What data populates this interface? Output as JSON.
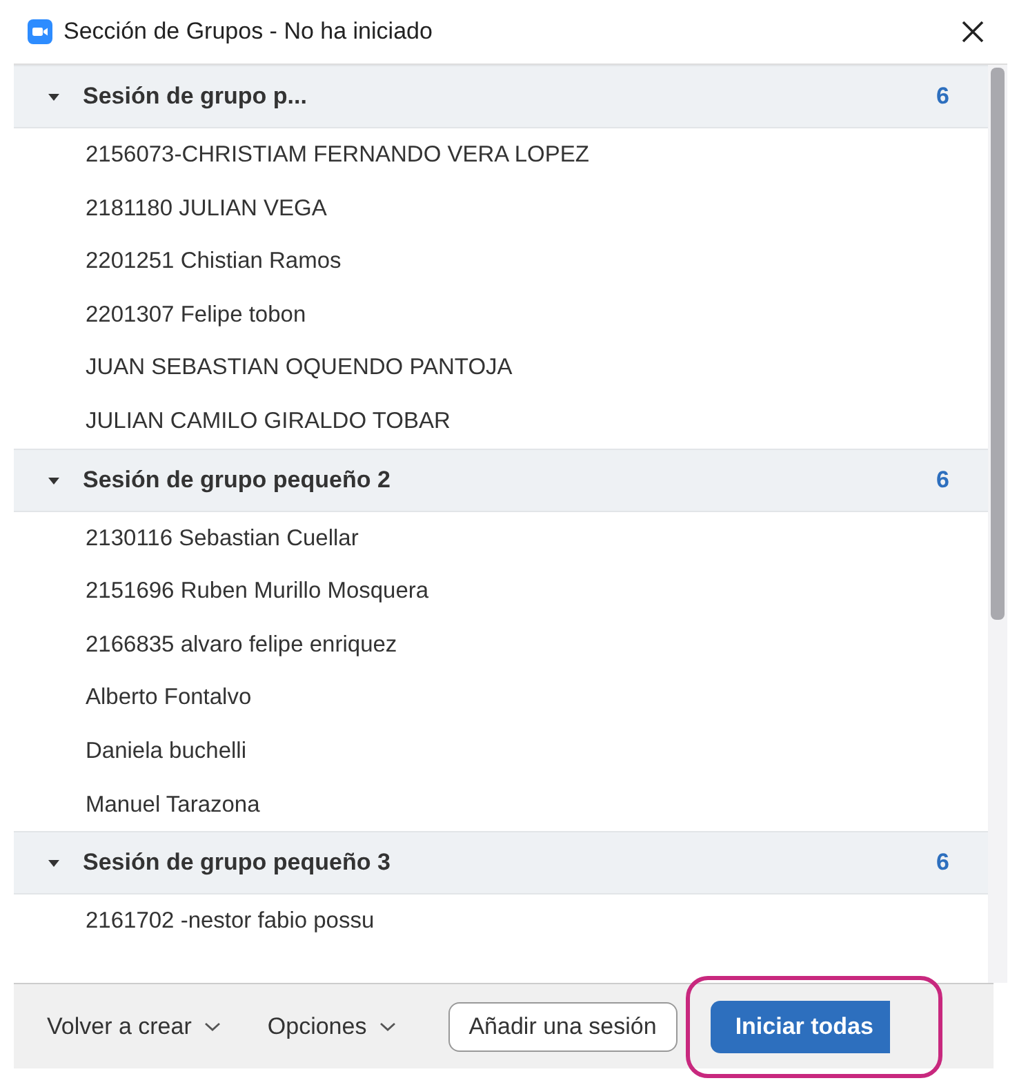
{
  "window": {
    "title": "Sección de Grupos - No ha iniciado"
  },
  "groups": [
    {
      "name": "Sesión de grupo p...",
      "count": "6",
      "expanded": true,
      "members": [
        "2156073-CHRISTIAM FERNANDO VERA LOPEZ",
        "2181180 JULIAN VEGA",
        "2201251 Chistian Ramos",
        "2201307 Felipe tobon",
        "JUAN SEBASTIAN OQUENDO PANTOJA",
        "JULIAN CAMILO GIRALDO TOBAR"
      ]
    },
    {
      "name": "Sesión de grupo pequeño 2",
      "count": "6",
      "expanded": true,
      "members": [
        "2130116 Sebastian Cuellar",
        "2151696 Ruben Murillo Mosquera",
        "2166835 alvaro felipe enriquez",
        "Alberto Fontalvo",
        "Daniela buchelli",
        "Manuel Tarazona"
      ]
    },
    {
      "name": "Sesión de grupo pequeño 3",
      "count": "6",
      "expanded": true,
      "members": [
        "2161702 -nestor fabio possu"
      ]
    }
  ],
  "footer": [
    {
      "kind": "dropdown",
      "label": "Volver a crear"
    },
    {
      "kind": "dropdown",
      "label": "Opciones"
    },
    {
      "kind": "outline",
      "label": "Añadir una sesión"
    },
    {
      "kind": "primary",
      "label": "Iniciar todas",
      "highlighted": true
    }
  ]
}
